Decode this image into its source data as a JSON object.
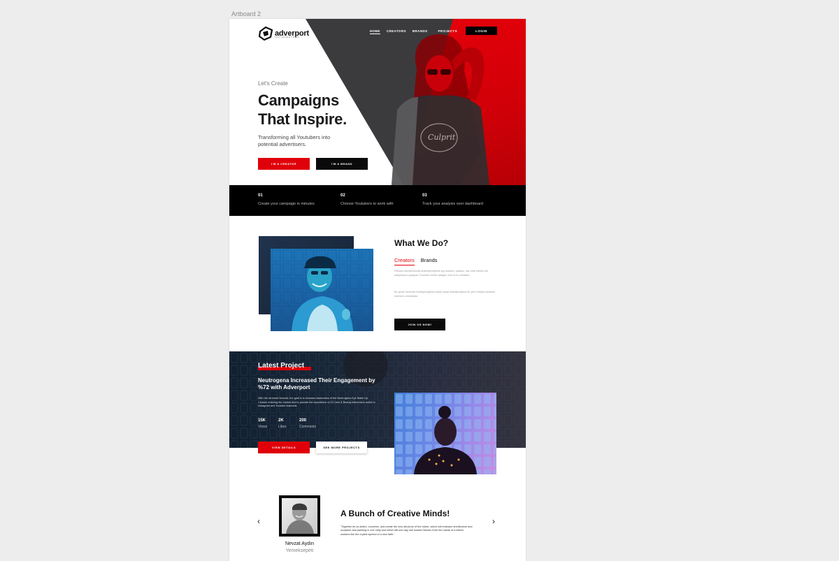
{
  "artboard_label": "Artboard 2",
  "brand": {
    "name": "adverport",
    "tagline": "JUST ADVERTISING"
  },
  "nav": {
    "items": [
      "HOME",
      "CREATORS",
      "BRANDS",
      "PROJECTS"
    ],
    "login": "LOGIN"
  },
  "hero": {
    "pre": "Let's Create",
    "title_line1": "Campaigns",
    "title_line2": "That Inspire.",
    "subtitle": "Transforming all Youtubers into potential advertisers.",
    "creator_btn": "I'M A CREATOR",
    "brand_btn": "I'M A BRAND",
    "shirt_text": "Culprit"
  },
  "steps": [
    {
      "num": "01",
      "text": "Create your campaign in minutes"
    },
    {
      "num": "02",
      "text": "Choose Youtubers to work with"
    },
    {
      "num": "03",
      "text": "Track your analysis over dashboard"
    }
  ],
  "what_we_do": {
    "title": "What We Do?",
    "tabs": [
      "Creators",
      "Brands"
    ],
    "para1": "Reklam formlarımızda tedirleyeceğimiz şey sadece, yaratıcı, kar elde etmek için çalışmanızı yaşayan Youtuber birinin adlığını verir ki bu olmaktır.",
    "para2": "Bu içerik üzerinde irdeleyeceğimiz kadar hayal edebileceğiniz bir yeni reklam yönetimi mümkün olmaktadır.",
    "join_btn": "JOIN US NOW!"
  },
  "latest_project": {
    "title": "Latest Project",
    "headline": "Neutrogena Increased Their Engagement by %72 with Adverport",
    "description": "With the renewed formula, the goal is to increase awareness of the Neutrogena Eye Make Up Cleaner entering the market and to provide the experience of 13 Care & Beauty influencers active in Instagram and Youtube channels.",
    "stats": [
      {
        "value": "15K",
        "label": "Views"
      },
      {
        "value": "2K",
        "label": "Likes"
      },
      {
        "value": "200",
        "label": "Comments"
      }
    ],
    "view_btn": "VIEW DETAILS",
    "more_btn": "SEE MORE PROJECTS"
  },
  "team": {
    "title": "A Bunch of Creative Minds!",
    "quote": "\"Together let us desire, conceive, and create the new structure of the future, which will embrace architecture and sculpture and painting in one unity and which will one day rise toward Heaven from the hands of a million workers like the crystal symbol of a new faith.\"",
    "person_name": "Nevzat Aydın",
    "person_company": "Yemeksepeti",
    "prev_arrow": "‹",
    "next_arrow": "›"
  },
  "colors": {
    "accent_red": "#e00009",
    "dark": "#0a0a0a",
    "hero_dark": "#3b3b3d",
    "blue_photo": "#1d74b8"
  }
}
